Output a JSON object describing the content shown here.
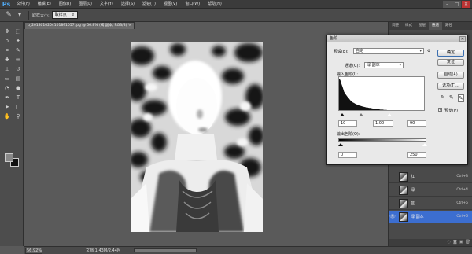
{
  "app": {
    "logo": "Ps",
    "menu": [
      "文件(F)",
      "编辑(E)",
      "图像(I)",
      "图层(L)",
      "文字(Y)",
      "选择(S)",
      "滤镜(T)",
      "视图(V)",
      "窗口(W)",
      "帮助(H)"
    ],
    "window_controls": [
      "–",
      "□",
      "✕"
    ]
  },
  "options_bar": {
    "tool_icon": "eyedropper-icon",
    "sample_size_label": "取样大小:",
    "sample_size_value": "取样点"
  },
  "document": {
    "tab_title": "u_2018010204101891057.jpg @ 56.8% (阈 副本, RGB/8) *",
    "close_glyph": "×"
  },
  "status": {
    "zoom": "56.92%",
    "doc_size": "文档:1.43M/2.44M"
  },
  "right_panel": {
    "tabs": [
      "调整",
      "样式",
      "图层",
      "通道",
      "路径"
    ],
    "active_tab": "通道",
    "layers": [
      {
        "name": "红",
        "shortcut": "Ctrl+3",
        "visible": false,
        "selected": false
      },
      {
        "name": "绿",
        "shortcut": "Ctrl+4",
        "visible": false,
        "selected": false
      },
      {
        "name": "蓝",
        "shortcut": "Ctrl+5",
        "visible": false,
        "selected": false
      },
      {
        "name": "绿 副本",
        "shortcut": "Ctrl+6",
        "visible": true,
        "selected": true
      }
    ],
    "eye_glyph": "👁"
  },
  "dialog": {
    "title": "色阶",
    "close_glyph": "✕",
    "preset_label": "预设(E):",
    "preset_value": "自定",
    "channel_label": "通道(C):",
    "channel_value": "绿 副本",
    "input_levels_label": "输入色阶(I):",
    "input_values": [
      "10",
      "1.00",
      "90"
    ],
    "output_levels_label": "输出色阶(O):",
    "output_values": [
      "0",
      "250"
    ],
    "buttons": {
      "ok": "确定",
      "reset": "复位",
      "auto": "自动(A)",
      "options": "选项(T)..."
    },
    "preview_label": "预览(P)",
    "preview_checked": true,
    "histogram": [
      96,
      92,
      80,
      70,
      58,
      52,
      47,
      42,
      38,
      33,
      30,
      27,
      25,
      23,
      21,
      20,
      18,
      17,
      16,
      15,
      14,
      13,
      12,
      12,
      11,
      11,
      10,
      9,
      9,
      8,
      8,
      7,
      7,
      6,
      6,
      6,
      5,
      5,
      5,
      4,
      4,
      4,
      4,
      3,
      3,
      3,
      3,
      3,
      2,
      2,
      2,
      2,
      2,
      2,
      2
    ]
  },
  "colors": {
    "accent": "#3c6ed0",
    "app_bg": "#5a5a5a",
    "dialog_bg": "#e9e9e9"
  }
}
